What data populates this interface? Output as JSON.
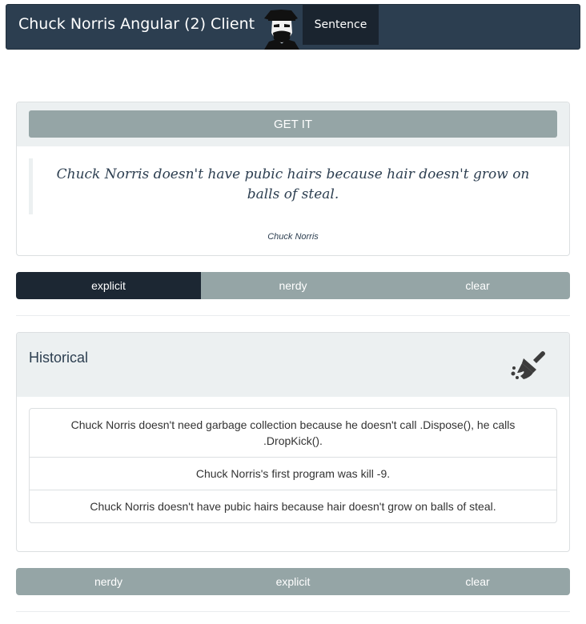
{
  "navbar": {
    "brand": "Chuck Norris Angular (2) Client",
    "logo_icon": "chuck-norris-silhouette-icon",
    "nav_item": "Sentence",
    "bg_color": "#2c3e50"
  },
  "quote_card": {
    "get_button": "GET IT",
    "quote": "Chuck Norris doesn't have pubic hairs because hair doesn't grow on balls of steal.",
    "author": "Chuck Norris"
  },
  "category_buttons_top": [
    {
      "label": "explicit",
      "active": true
    },
    {
      "label": "nerdy",
      "active": false
    },
    {
      "label": "clear",
      "active": false
    }
  ],
  "historical": {
    "title": "Historical",
    "clear_icon": "broom-icon",
    "items": [
      "Chuck Norris doesn't need garbage collection because he doesn't call .Dispose(), he calls .DropKick().",
      "Chuck Norris's first program was kill -9.",
      "Chuck Norris doesn't have pubic hairs because hair doesn't grow on balls of steal."
    ]
  },
  "category_buttons_bottom": [
    {
      "label": "nerdy",
      "active": false
    },
    {
      "label": "explicit",
      "active": false
    },
    {
      "label": "clear",
      "active": false
    }
  ],
  "colors": {
    "primary": "#2c3e50",
    "secondary": "#95a5a6",
    "active": "#1c2733",
    "light": "#ecf0f1"
  }
}
